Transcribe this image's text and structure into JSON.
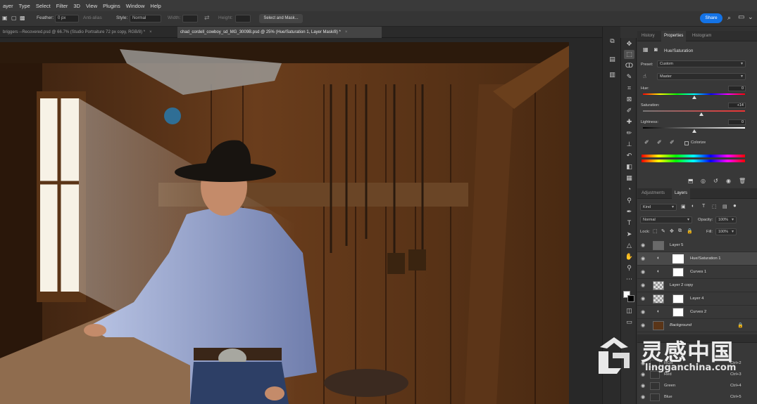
{
  "menu": [
    "ayer",
    "Type",
    "Select",
    "Filter",
    "3D",
    "View",
    "Plugins",
    "Window",
    "Help"
  ],
  "options": {
    "feather_label": "Feather:",
    "feather_value": "0 px",
    "antialias_label": "Anti-alias",
    "style_label": "Style:",
    "style_value": "Normal",
    "width_label": "Width:",
    "height_label": "Height:",
    "select_mask": "Select and Mask...",
    "share": "Share"
  },
  "tabs": [
    {
      "label": "briggers --Recovered.psd @ 66.7% (Studio Portraiture 72 px copy, RGB/8) *",
      "active": false
    },
    {
      "label": "chad_cordell_cowboy_sd_MG_3009B.psd @ 25% (Hue/Saturation 1, Layer Mask/8) *",
      "active": true
    }
  ],
  "properties": {
    "tabs": [
      "History",
      "Properties",
      "Histogram"
    ],
    "title": "Hue/Saturation",
    "preset_label": "Preset:",
    "preset_value": "Custom",
    "channel": "Master",
    "hue_label": "Hue:",
    "hue_value": "0",
    "sat_label": "Saturation:",
    "sat_value": "+14",
    "light_label": "Lightness:",
    "light_value": "0",
    "colorize": "Colorize",
    "hue_pos": 0.5,
    "sat_pos": 0.57,
    "light_pos": 0.5
  },
  "layers": {
    "tabs": [
      "Adjustments",
      "Layers"
    ],
    "filter": "Kind",
    "blend": "Normal",
    "opacity_label": "Opacity:",
    "opacity": "100%",
    "lock_label": "Lock:",
    "fill_label": "Fill:",
    "fill": "100%",
    "items": [
      {
        "name": "Layer 5",
        "selected": false
      },
      {
        "name": "Hue/Saturation 1",
        "selected": true
      },
      {
        "name": "Curves 1",
        "selected": false
      },
      {
        "name": "Layer 2 copy",
        "selected": false
      },
      {
        "name": "Layer 4",
        "selected": false
      },
      {
        "name": "Curves 2",
        "selected": false
      },
      {
        "name": "Background",
        "selected": false
      }
    ]
  },
  "channels": {
    "items": [
      {
        "name": "RGB",
        "shortcut": "Ctrl+2"
      },
      {
        "name": "Red",
        "shortcut": "Ctrl+3"
      },
      {
        "name": "Green",
        "shortcut": "Ctrl+4"
      },
      {
        "name": "Blue",
        "shortcut": "Ctrl+5"
      }
    ]
  },
  "watermark": {
    "cn": "灵感中国",
    "en": "lingganchina.com"
  },
  "colors": {
    "accent": "#1473e6",
    "panel": "#383838",
    "wood": "#5a3518"
  }
}
